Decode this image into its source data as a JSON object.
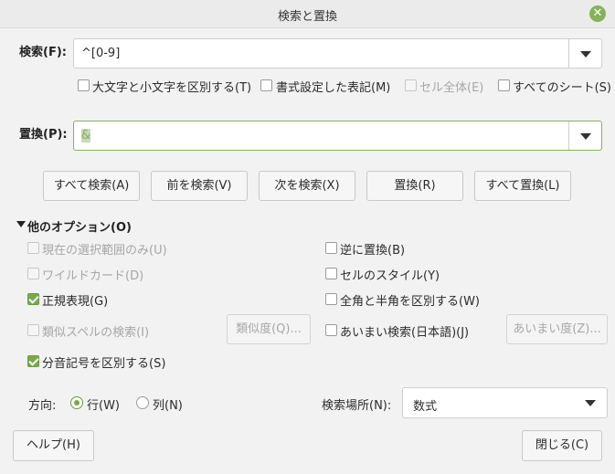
{
  "window": {
    "title": "検索と置換"
  },
  "search": {
    "label": "検索(F):",
    "value": "^[0-9]"
  },
  "search_options": {
    "match_case": {
      "label": "大文字と小文字を区別する(T)",
      "checked": false,
      "enabled": true
    },
    "formatted": {
      "label": "書式設定した表記(M)",
      "checked": false,
      "enabled": true
    },
    "entire_cells": {
      "label": "セル全体(E)",
      "checked": false,
      "enabled": false
    },
    "all_sheets": {
      "label": "すべてのシート(S)",
      "checked": false,
      "enabled": true
    }
  },
  "replace": {
    "label": "置換(P):",
    "value": "&"
  },
  "buttons": {
    "find_all": "すべて検索(A)",
    "find_prev": "前を検索(V)",
    "find_next": "次を検索(X)",
    "replace": "置換(R)",
    "replace_all": "すべて置換(L)"
  },
  "other_options": {
    "header": "他のオプション(O)",
    "current_selection": {
      "label": "現在の選択範囲のみ(U)",
      "checked": false,
      "enabled": false
    },
    "wildcards": {
      "label": "ワイルドカード(D)",
      "checked": false,
      "enabled": false
    },
    "regex": {
      "label": "正規表現(G)",
      "checked": true,
      "enabled": true
    },
    "similarity": {
      "label": "類似スペルの検索(I)",
      "checked": false,
      "enabled": false
    },
    "similarity_button": "類似度(Q)...",
    "diacritics": {
      "label": "分音記号を区別する(S)",
      "checked": true,
      "enabled": true
    },
    "backwards": {
      "label": "逆に置換(B)",
      "checked": false,
      "enabled": true
    },
    "cell_styles": {
      "label": "セルのスタイル(Y)",
      "checked": false,
      "enabled": true
    },
    "match_width": {
      "label": "全角と半角を区別する(W)",
      "checked": false,
      "enabled": true
    },
    "sounds_like": {
      "label": "あいまい検索(日本語)(J)",
      "checked": false,
      "enabled": true
    },
    "sounds_like_button": "あいまい度(Z)..."
  },
  "direction": {
    "label": "方向:",
    "rows": "行(W)",
    "columns": "列(N)",
    "selected": "rows"
  },
  "search_in": {
    "label": "検索場所(N):",
    "value": "数式"
  },
  "footer": {
    "help": "ヘルプ(H)",
    "close": "閉じる(C)"
  },
  "colors": {
    "accent": "#79a84d",
    "close_button": "#86b25a"
  }
}
